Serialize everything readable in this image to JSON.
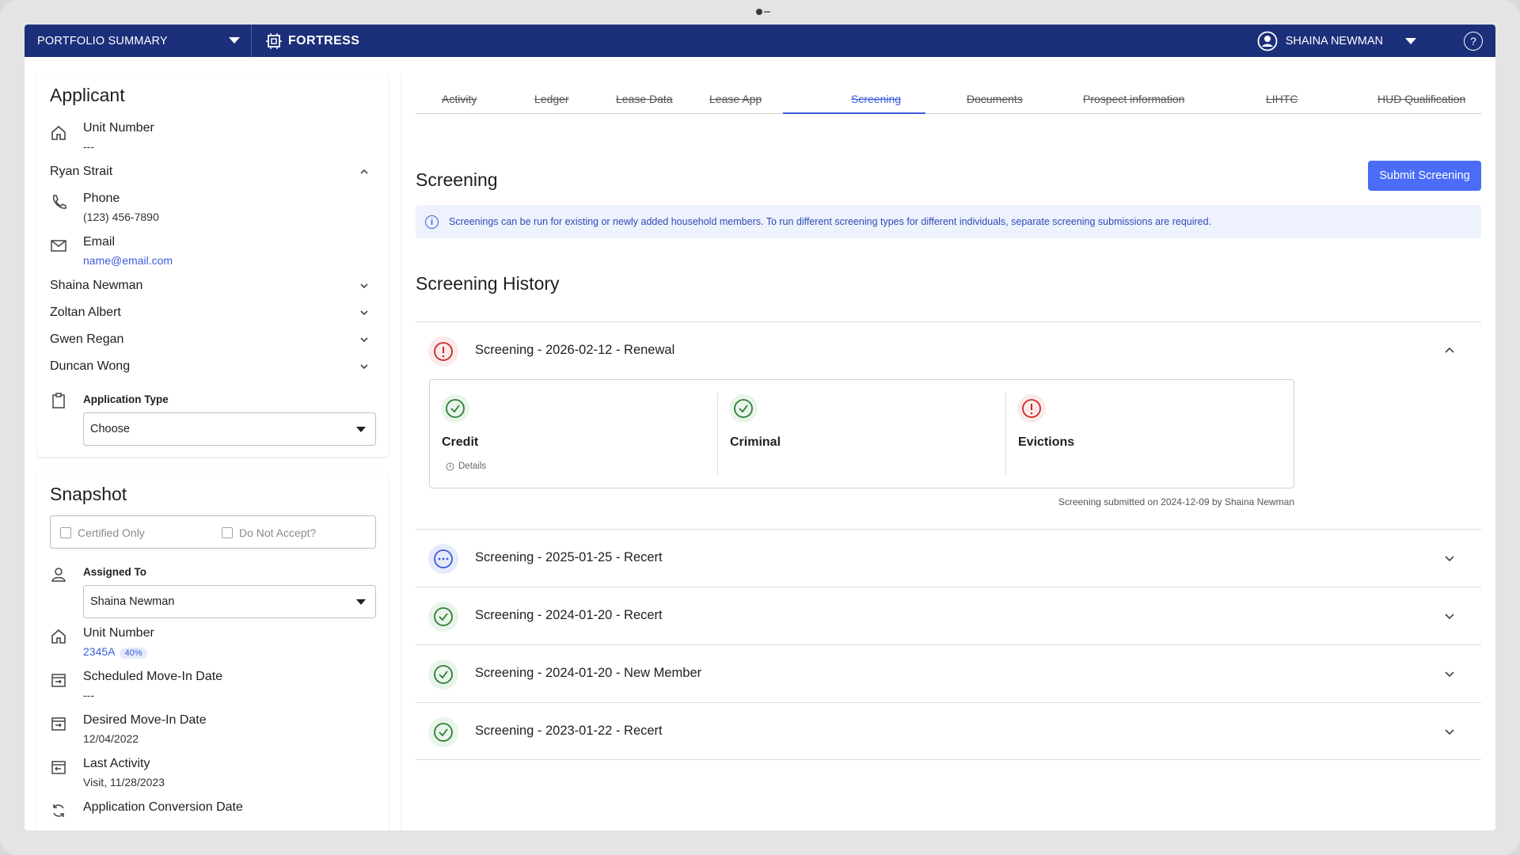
{
  "topbar": {
    "portfolio_label": "PORTFOLIO SUMMARY",
    "brand": "FORTRESS",
    "user_name": "SHAINA NEWMAN",
    "help_glyph": "?"
  },
  "applicant": {
    "title": "Applicant",
    "unit_label": "Unit Number",
    "unit_value": "---",
    "primary_person": "Ryan Strait",
    "phone_label": "Phone",
    "phone_value": "(123) 456-7890",
    "email_label": "Email",
    "email_value": "name@email.com",
    "other_people": [
      "Shaina Newman",
      "Zoltan Albert",
      "Gwen Regan",
      "Duncan Wong"
    ],
    "application_type_label": "Application Type",
    "application_type_value": "Choose"
  },
  "snapshot": {
    "title": "Snapshot",
    "certified_only": "Certified Only",
    "do_not_accept": "Do Not Accept?",
    "assigned_to_label": "Assigned To",
    "assigned_to_value": "Shaina Newman",
    "unit_label": "Unit Number",
    "unit_value": "2345A",
    "unit_badge": "40%",
    "scheduled_label": "Scheduled Move-In Date",
    "scheduled_value": "---",
    "desired_label": "Desired Move-In Date",
    "desired_value": "12/04/2022",
    "last_activity_label": "Last Activity",
    "last_activity_value": "Visit, 11/28/2023",
    "conversion_label": "Application Conversion Date"
  },
  "tabs": [
    "Activity",
    "Ledger",
    "Lease Data",
    "Lease App",
    "Screening",
    "Documents",
    "Prospect information",
    "LIHTC",
    "HUD Qualification"
  ],
  "main": {
    "title": "Screening",
    "submit_label": "Submit Screening",
    "info_icon": "i",
    "info_text": "Screenings can be run for existing or newly added household members. To run different screening types for different individuals, separate screening submissions are required.",
    "history_title": "Screening History",
    "submitted_note": "Screening submitted on 2024-12-09 by Shaina Newman",
    "details_label": "Details"
  },
  "screenings": [
    {
      "name": "Screening - 2026-02-12 - Renewal",
      "status": "error",
      "expanded": true
    },
    {
      "name": "Screening - 2025-01-25 - Recert",
      "status": "pending",
      "expanded": false
    },
    {
      "name": "Screening - 2024-01-20 - Recert",
      "status": "success",
      "expanded": false
    },
    {
      "name": "Screening - 2024-01-20 - New Member",
      "status": "success",
      "expanded": false
    },
    {
      "name": "Screening - 2023-01-22 - Recert",
      "status": "success",
      "expanded": false
    }
  ],
  "screening_details": [
    {
      "name": "Credit",
      "status": "success"
    },
    {
      "name": "Criminal",
      "status": "success"
    },
    {
      "name": "Evictions",
      "status": "error"
    }
  ],
  "colors": {
    "topbar": "#1c2f7a",
    "accent": "#4a6cf7",
    "success": "#2e7d32",
    "error": "#c62828"
  }
}
